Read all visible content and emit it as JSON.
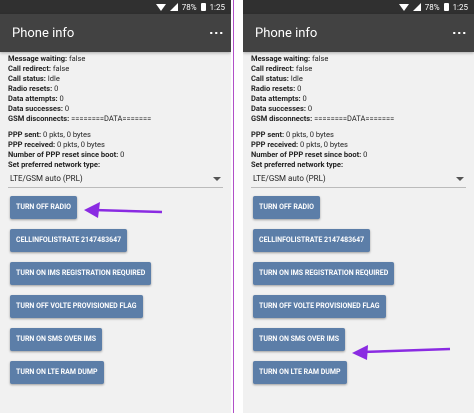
{
  "status": {
    "battery_text": "78%",
    "time": "1:25"
  },
  "screens": [
    {
      "title": "Phone info",
      "lines": [
        {
          "label": "Message waiting:",
          "value": "false"
        },
        {
          "label": "Call redirect:",
          "value": "false"
        },
        {
          "label": "Call status:",
          "value": "Idle"
        },
        {
          "label": "Radio resets:",
          "value": "0"
        },
        {
          "label": "Data attempts:",
          "value": "0"
        },
        {
          "label": "Data successes:",
          "value": "0"
        },
        {
          "label": "GSM disconnects:",
          "value": "========DATA======="
        }
      ],
      "lines2": [
        {
          "label": "PPP sent:",
          "value": "0 pkts, 0 bytes"
        },
        {
          "label": "PPP received:",
          "value": "0 pkts, 0 bytes"
        },
        {
          "label": "Number of PPP reset since boot:",
          "value": "0"
        },
        {
          "label": "Set preferred network type:",
          "value": ""
        }
      ],
      "network_type": "LTE/GSM auto (PRL)",
      "buttons": [
        "TURN OFF RADIO",
        "CELLINFOLISTRATE 2147483647",
        "TURN ON IMS REGISTRATION REQUIRED",
        "TURN OFF VOLTE PROVISIONED FLAG",
        "TURN ON SMS OVER IMS",
        "TURN ON LTE RAM DUMP"
      ]
    },
    {
      "title": "Phone info",
      "lines": [
        {
          "label": "Message waiting:",
          "value": "false"
        },
        {
          "label": "Call redirect:",
          "value": "false"
        },
        {
          "label": "Call status:",
          "value": "Idle"
        },
        {
          "label": "Radio resets:",
          "value": "0"
        },
        {
          "label": "Data attempts:",
          "value": "0"
        },
        {
          "label": "Data successes:",
          "value": "0"
        },
        {
          "label": "GSM disconnects:",
          "value": "========DATA======="
        }
      ],
      "lines2": [
        {
          "label": "PPP sent:",
          "value": "0 pkts, 0 bytes"
        },
        {
          "label": "PPP received:",
          "value": "0 pkts, 0 bytes"
        },
        {
          "label": "Number of PPP reset since boot:",
          "value": "0"
        },
        {
          "label": "Set preferred network type:",
          "value": ""
        }
      ],
      "network_type": "LTE/GSM auto (PRL)",
      "buttons": [
        "TURN OFF RADIO",
        "CELLINFOLISTRATE 2147483647",
        "TURN ON IMS REGISTRATION REQUIRED",
        "TURN OFF VOLTE PROVISIONED FLAG",
        "TURN ON SMS OVER IMS",
        "TURN ON LTE RAM DUMP"
      ]
    }
  ],
  "colors": {
    "arrow": "#8a2be2",
    "button": "#5c7ea8",
    "appbar": "#424242"
  },
  "icons": {
    "menu": "overflow-menu-icon",
    "wifi": "wifi-icon",
    "signal": "signal-icon",
    "battery": "battery-icon"
  }
}
